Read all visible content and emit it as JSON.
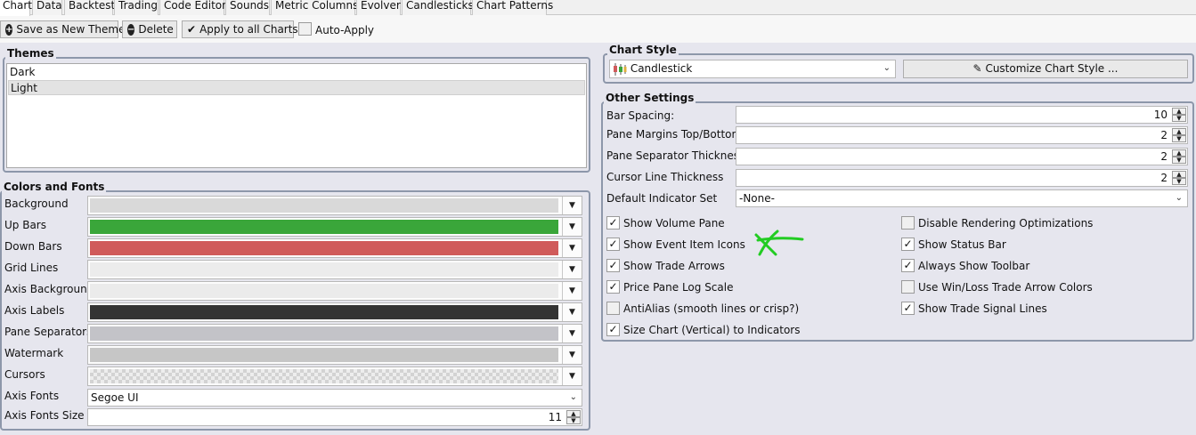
{
  "tabs": [
    "Chart",
    "Data",
    "Backtest",
    "Trading",
    "Code Editor",
    "Sounds",
    "Metric Columns",
    "Evolver",
    "Candlesticks",
    "Chart Patterns"
  ],
  "toolbar": {
    "save_label": "Save as New Theme",
    "delete_label": "Delete",
    "apply_label": "Apply to all Charts",
    "auto_apply_label": "Auto-Apply",
    "auto_apply_checked": false
  },
  "themes": {
    "title": "Themes",
    "items": [
      "Dark",
      "Light"
    ],
    "selected": "Light"
  },
  "colors_fonts": {
    "title": "Colors and Fonts",
    "rows": [
      {
        "label": "Background",
        "color": "#d9d9d9"
      },
      {
        "label": "Up Bars",
        "color": "#3aa63a"
      },
      {
        "label": "Down Bars",
        "color": "#d05a5a"
      },
      {
        "label": "Grid Lines",
        "color": "#ececec"
      },
      {
        "label": "Axis Background",
        "color": "#ebebeb"
      },
      {
        "label": "Axis Labels",
        "color": "#333333"
      },
      {
        "label": "Pane Separators",
        "color": "#c3c3c8"
      },
      {
        "label": "Watermark",
        "color": "#c6c6c6"
      },
      {
        "label": "Cursors",
        "color": "checker"
      }
    ],
    "axis_fonts_label": "Axis Fonts",
    "axis_fonts_value": "Segoe UI",
    "axis_fonts_size_label": "Axis Fonts Size",
    "axis_fonts_size_value": "11"
  },
  "chart_style": {
    "title": "Chart Style",
    "value": "Candlestick",
    "customize_label": "Customize Chart Style ..."
  },
  "other_settings": {
    "title": "Other Settings",
    "bar_spacing_label": "Bar Spacing:",
    "bar_spacing_value": "10",
    "pane_margins_label": "Pane Margins Top/Bottom:",
    "pane_margins_value": "2",
    "pane_sep_label": "Pane Separator Thickness",
    "pane_sep_value": "2",
    "cursor_line_label": "Cursor Line Thickness",
    "cursor_line_value": "2",
    "default_indicator_label": "Default Indicator Set",
    "default_indicator_value": "-None-",
    "left_checks": [
      {
        "label": "Show Volume Pane",
        "checked": true
      },
      {
        "label": "Show Event Item Icons",
        "checked": true
      },
      {
        "label": "Show Trade Arrows",
        "checked": true
      },
      {
        "label": "Price Pane Log Scale",
        "checked": true
      },
      {
        "label": "AntiAlias (smooth lines or crisp?)",
        "checked": false
      },
      {
        "label": "Size Chart (Vertical) to Indicators",
        "checked": true
      }
    ],
    "right_checks": [
      {
        "label": "Disable Rendering Optimizations",
        "checked": false
      },
      {
        "label": "Show Status Bar",
        "checked": true
      },
      {
        "label": "Always Show Toolbar",
        "checked": true
      },
      {
        "label": "Use Win/Loss Trade Arrow Colors",
        "checked": false
      },
      {
        "label": "Show Trade Signal Lines",
        "checked": true
      }
    ]
  },
  "annotation_color": "#22cc22"
}
